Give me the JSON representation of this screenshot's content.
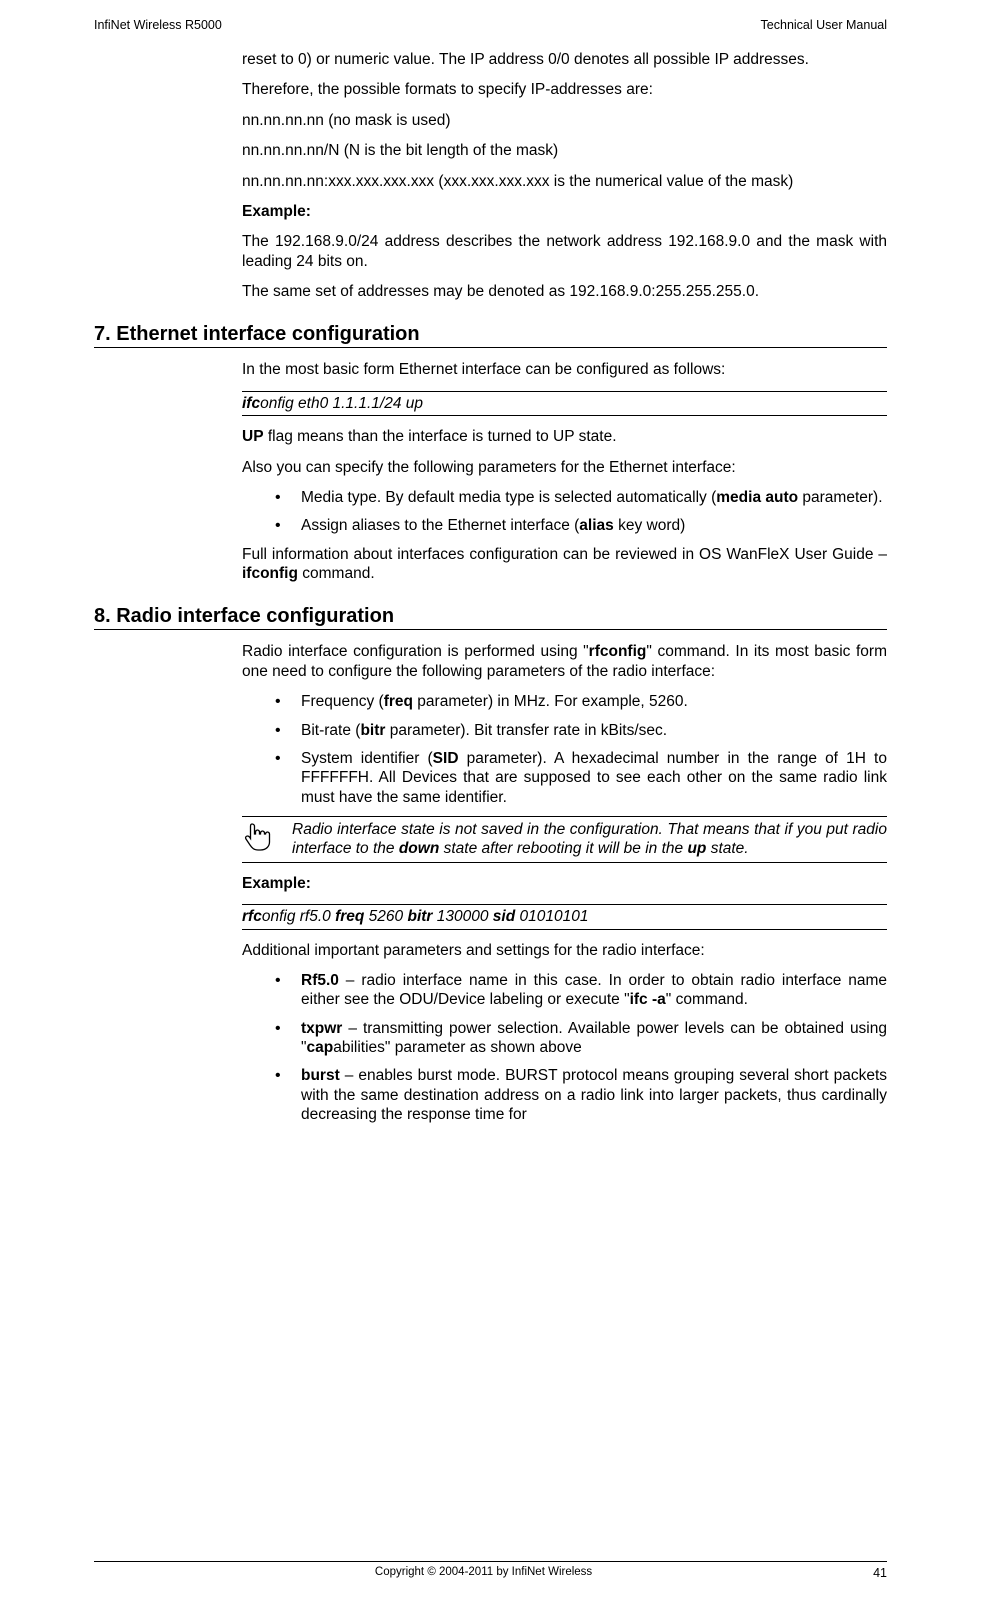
{
  "header": {
    "left": "InfiNet Wireless R5000",
    "right": "Technical User Manual"
  },
  "intro": {
    "p1": "reset to 0) or numeric value. The IP address 0/0 denotes all possible IP addresses.",
    "p2": "Therefore, the possible formats to specify IP-addresses are:",
    "p3": "nn.nn.nn.nn (no mask is used)",
    "p4": "nn.nn.nn.nn/N (N is the bit length of the mask)",
    "p5": "nn.nn.nn.nn:xxx.xxx.xxx.xxx (xxx.xxx.xxx.xxx is the numerical value of the mask)",
    "example_label": "Example:",
    "p6": "The 192.168.9.0/24 address describes the network address 192.168.9.0 and the mask with leading 24 bits on.",
    "p7": "The same set of addresses may be denoted as 192.168.9.0:255.255.255.0."
  },
  "sec7": {
    "heading": "7. Ethernet interface configuration",
    "p1": "In the most basic form Ethernet interface can be configured as follows:",
    "cmd": {
      "cfg": "ifc",
      "onfig": "onfig ",
      "eth": "eth0 1.1.1.1/24 ",
      "up": "up"
    },
    "p2a": "UP",
    "p2b": " flag means than the interface is turned to UP state.",
    "p3": "Also you can specify the following parameters for the Ethernet interface:",
    "li1a": "Media type. By default media type is selected automatically (",
    "li1b": "media auto",
    "li1c": " parameter).",
    "li2a": "Assign aliases to the Ethernet interface (",
    "li2b": "alias",
    "li2c": " key word)",
    "p4a": "Full information about interfaces configuration can be reviewed in OS WanFleX User Guide – ",
    "p4b": "ifconfig",
    "p4c": " command."
  },
  "sec8": {
    "heading": "8. Radio interface configuration",
    "p1a": "Radio interface configuration is performed using \"",
    "p1b": "rfconfig",
    "p1c": "\" command. In its most basic form one need to configure the following parameters of the radio interface:",
    "li1a": "Frequency (",
    "li1b": "freq",
    "li1c": " parameter) in MHz. For example, 5260.",
    "li2a": "Bit-rate (",
    "li2b": "bitr",
    "li2c": " parameter). Bit transfer rate in kBits/sec.",
    "li3a": "System identifier (",
    "li3b": "SID",
    "li3c": " parameter). A hexadecimal number in the range of 1H to FFFFFFH. All Devices that are supposed to see each other on the same radio link must have the same identifier.",
    "note_a": "Radio interface state is not saved in the configuration. That means that if you put radio interface to the ",
    "note_b": "down",
    "note_c": " state after rebooting it will be in the ",
    "note_d": "up",
    "note_e": " state.",
    "example_label": "Example:",
    "cmd": {
      "rfc": "rfc",
      "onfig": "onfig ",
      "rf50": "rf5.0 ",
      "freq": "freq",
      "v1": " 5260 ",
      "bitr": "bitr",
      "v2": " 130000 ",
      "sid": "sid",
      "v3": " 01010101"
    },
    "p2": "Additional important parameters and settings for the radio interface:",
    "b1a": "Rf5.0",
    "b1b": " – radio interface name in this case. In order to obtain radio interface name either see the ODU/Device labeling or execute \"",
    "b1c": "ifc -a",
    "b1d": "\" command.",
    "b2a": "txpwr",
    "b2b": " – transmitting power selection. Available power levels can be obtained using \"",
    "b2c": "cap",
    "b2d": "abilities\" parameter as shown above",
    "b3a": "burst ",
    "b3b": "– enables burst mode. BURST protocol means grouping several short packets with the same destination address on a radio link into larger packets, thus cardinally decreasing the response time for"
  },
  "footer": {
    "copyright": "Copyright © 2004-2011 by InfiNet Wireless",
    "page": "41"
  }
}
